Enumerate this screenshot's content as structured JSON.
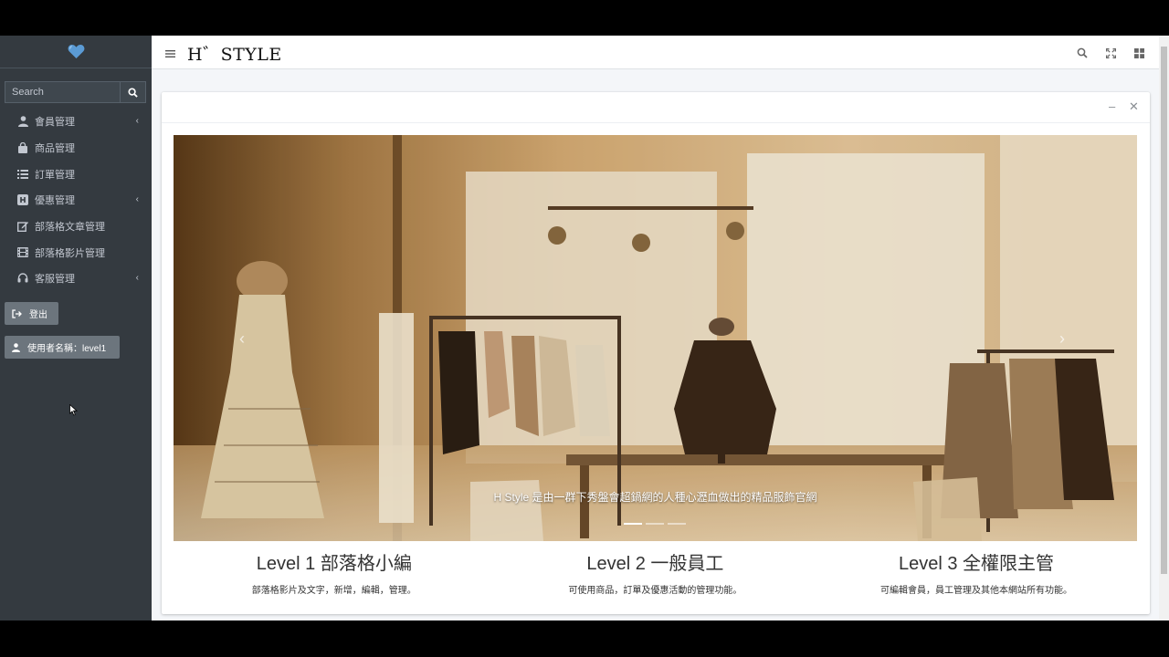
{
  "colors": {
    "sidebar_bg": "#343a40",
    "brand_heart": "#5b9bd5",
    "secondary_btn": "#6c757d"
  },
  "sidebar": {
    "brand_icon": "heart-icon",
    "search": {
      "placeholder": "Search",
      "button_icon": "search-icon"
    },
    "items": [
      {
        "label": "會員管理",
        "icon": "user-icon",
        "has_submenu": true
      },
      {
        "label": "商品管理",
        "icon": "shopping-bag-icon",
        "has_submenu": false
      },
      {
        "label": "訂單管理",
        "icon": "list-icon",
        "has_submenu": false
      },
      {
        "label": "優惠管理",
        "icon": "h-square-icon",
        "has_submenu": true
      },
      {
        "label": "部落格文章管理",
        "icon": "edit-icon",
        "has_submenu": false
      },
      {
        "label": "部落格影片管理",
        "icon": "film-icon",
        "has_submenu": false
      },
      {
        "label": "客服管理",
        "icon": "headset-icon",
        "has_submenu": true
      }
    ],
    "logout_label": "登出",
    "user_label": "使用者名稱：level1"
  },
  "topbar": {
    "logo": "H゛STYLE",
    "menu_icon": "hamburger-icon",
    "right_icons": [
      "search-icon",
      "fullscreen-icon",
      "apps-grid-icon"
    ]
  },
  "card": {
    "tools": [
      "minimize-icon",
      "close-icon"
    ],
    "carousel": {
      "caption": "H Style 是由一群下秀盤會超鍋網的人種心瀝血做出的精品服飾官網",
      "slide_count": 3,
      "active_slide": 1
    },
    "levels": [
      {
        "title": "Level 1 部落格小編",
        "desc": "部落格影片及文字，新增，編輯，管理。"
      },
      {
        "title": "Level 2 一般員工",
        "desc": "可使用商品，訂單及優惠活動的管理功能。"
      },
      {
        "title": "Level 3 全權限主管",
        "desc": "可編輯會員，員工管理及其他本網站所有功能。"
      }
    ]
  }
}
